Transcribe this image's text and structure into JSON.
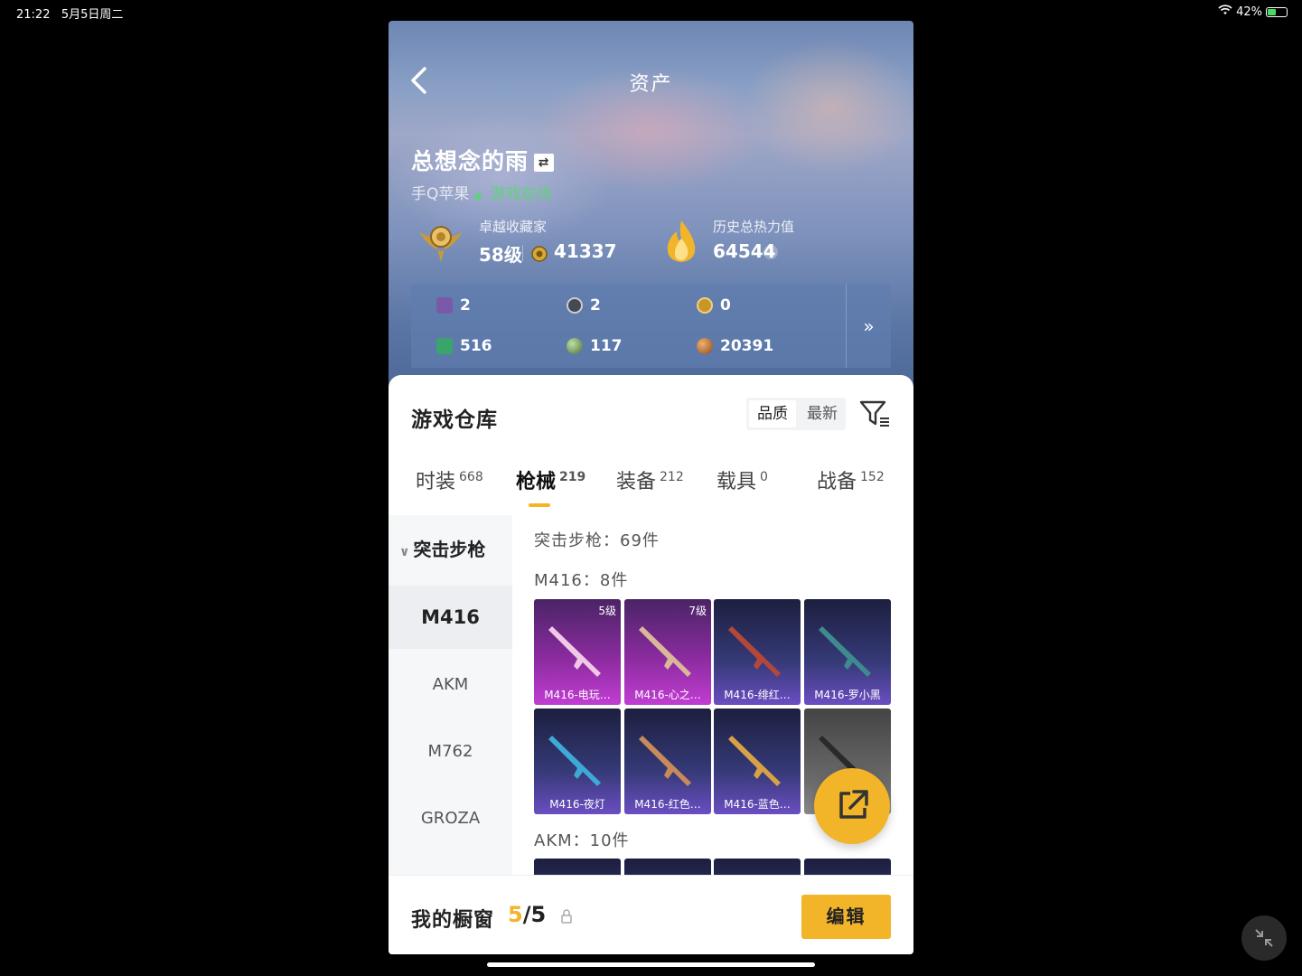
{
  "status_bar": {
    "time": "21:22",
    "date": "5月5日周二",
    "battery": "42%"
  },
  "header": {
    "title": "资产"
  },
  "profile": {
    "username": "总想念的雨",
    "account": "手Q苹果",
    "online_status": "游戏在线",
    "collector": {
      "label": "卓越收藏家",
      "level": "58级",
      "points": "41337"
    },
    "heat": {
      "label": "历史总热力值",
      "value": "64544",
      "help": "?"
    }
  },
  "currencies": [
    {
      "name": "card-icon",
      "value": "2",
      "color": "#7a5aa8"
    },
    {
      "name": "coin-s-icon",
      "value": "2",
      "color": "#444a55"
    },
    {
      "name": "coin-gold-icon",
      "value": "0",
      "color": "#c9962a"
    },
    {
      "name": "ticket-icon",
      "value": "516",
      "color": "#3aa56a"
    },
    {
      "name": "orb-icon",
      "value": "117",
      "color": "#5e7a5a"
    },
    {
      "name": "bronze-coin-icon",
      "value": "20391",
      "color": "#c07a3a"
    }
  ],
  "currency_more": "»",
  "warehouse": {
    "title": "游戏仓库",
    "sort_options": [
      "品质",
      "最新"
    ],
    "tabs": [
      {
        "label": "时装",
        "count": "668"
      },
      {
        "label": "枪械",
        "count": "219"
      },
      {
        "label": "装备",
        "count": "212"
      },
      {
        "label": "载具",
        "count": "0"
      },
      {
        "label": "战备",
        "count": "152"
      }
    ],
    "sidebar": {
      "category": "突击步枪",
      "items": [
        "M416",
        "AKM",
        "M762",
        "GROZA"
      ]
    },
    "content": {
      "category_total": "突击步枪：69件",
      "m416_group": "M416：8件",
      "akm_group": "AKM：10件",
      "m416_items": [
        {
          "name": "M416-电玩…",
          "level": "5级",
          "tier": "legend"
        },
        {
          "name": "M416-心之…",
          "level": "7级",
          "tier": "legend"
        },
        {
          "name": "M416-绯红…",
          "level": "",
          "tier": "epic"
        },
        {
          "name": "M416-罗小黑",
          "level": "",
          "tier": "epic"
        },
        {
          "name": "M416-夜灯",
          "level": "",
          "tier": "epic"
        },
        {
          "name": "M416-红色…",
          "level": "",
          "tier": "epic"
        },
        {
          "name": "M416-蓝色…",
          "level": "",
          "tier": "epic"
        },
        {
          "name": "",
          "level": "",
          "tier": "grey"
        }
      ]
    }
  },
  "showcase": {
    "label": "我的橱窗",
    "current": "5",
    "total": "/5",
    "edit_label": "编辑"
  },
  "colors": {
    "accent": "#f2b428",
    "online": "#5fd37a"
  }
}
